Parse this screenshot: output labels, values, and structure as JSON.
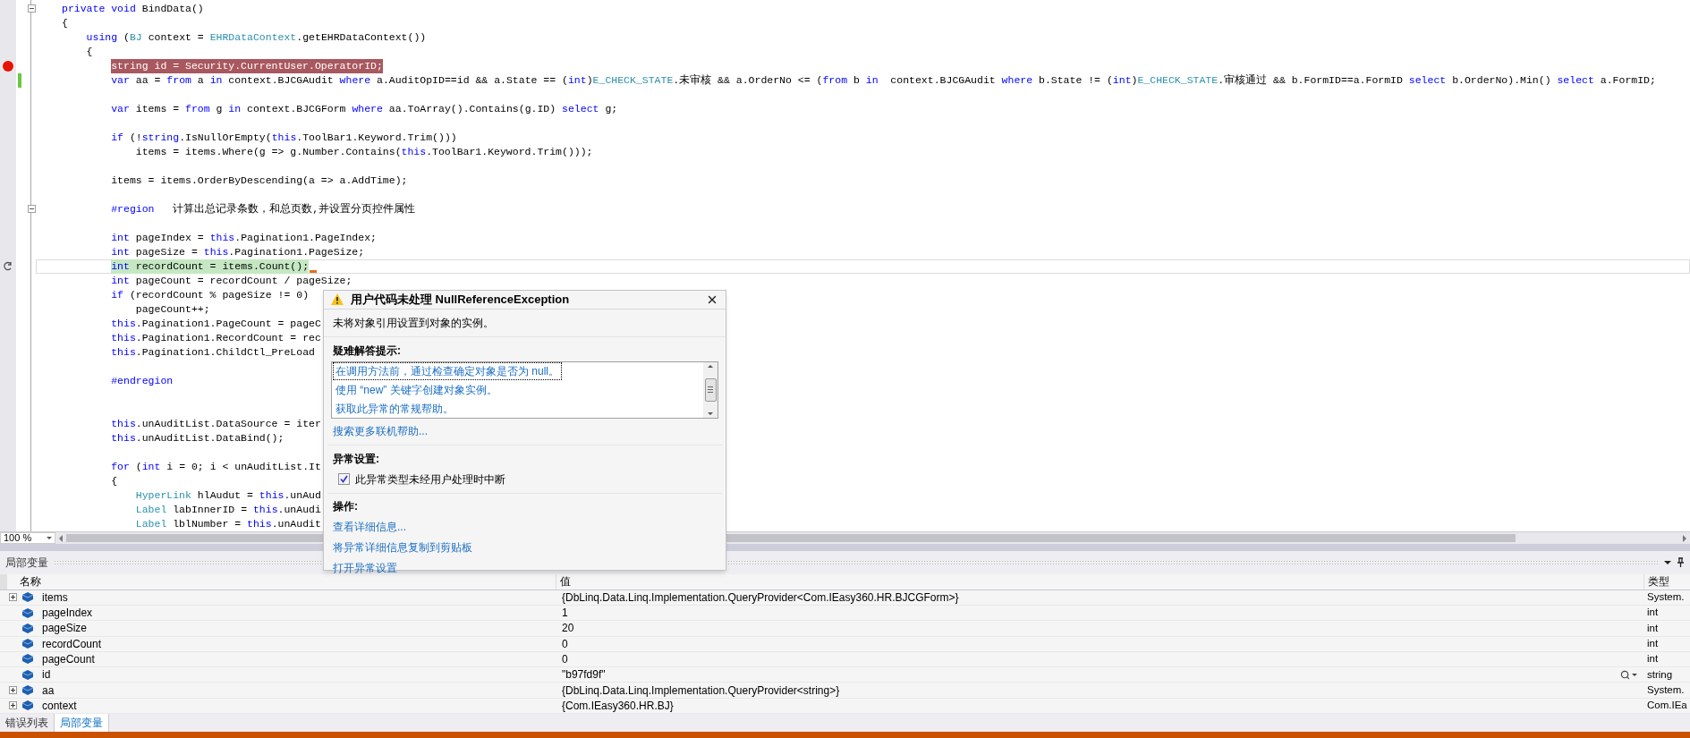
{
  "editor": {
    "lines": [
      {
        "kind": "code",
        "tokens": [
          {
            "kind": "keyword",
            "text": "private"
          },
          {
            "kind": "keyword",
            "text": " void"
          },
          {
            "kind": "plain",
            "text": " BindData()"
          }
        ],
        "foldable": true
      },
      {
        "kind": "code",
        "tokens": [
          {
            "kind": "plain",
            "text": "{"
          }
        ],
        "children": [
          {
            "kind": "code",
            "tokens": [
              {
                "kind": "keyword",
                "text": "using"
              },
              {
                "kind": "plain",
                "text": " ("
              },
              {
                "kind": "type",
                "text": "BJ"
              },
              {
                "kind": "plain",
                "text": " context = "
              },
              {
                "kind": "type",
                "text": "EHRDataContext"
              },
              {
                "kind": "plain",
                "text": ".getEHRDataContext())"
              }
            ]
          },
          {
            "kind": "code",
            "tokens": [
              {
                "kind": "plain",
                "text": "{"
              }
            ],
            "children": [
              {
                "kind": "code",
                "tokens": [
                  {
                    "kind": "plain",
                    "text": "string id = Security.CurrentUser.OperatorID;"
                  }
                ],
                "breakpoint": true
              },
              {
                "kind": "code",
                "tokens": [
                  {
                    "kind": "keyword",
                    "text": "var"
                  },
                  {
                    "kind": "plain",
                    "text": " aa = "
                  },
                  {
                    "kind": "keyword",
                    "text": "from"
                  },
                  {
                    "kind": "plain",
                    "text": " a "
                  },
                  {
                    "kind": "keyword",
                    "text": "in"
                  },
                  {
                    "kind": "plain",
                    "text": " context.BJCGAudit "
                  },
                  {
                    "kind": "keyword",
                    "text": "where"
                  },
                  {
                    "kind": "plain",
                    "text": " a.AuditOpID==id && a.State == ("
                  },
                  {
                    "kind": "keyword",
                    "text": "int"
                  },
                  {
                    "kind": "plain",
                    "text": ")"
                  },
                  {
                    "kind": "type",
                    "text": "E_CHECK_STATE"
                  },
                  {
                    "kind": "plain",
                    "text": ".未审核 && a.OrderNo <= ("
                  },
                  {
                    "kind": "keyword",
                    "text": "from"
                  },
                  {
                    "kind": "plain",
                    "text": " b "
                  },
                  {
                    "kind": "keyword",
                    "text": "in"
                  },
                  {
                    "kind": "plain",
                    "text": "  context.BJCGAudit "
                  },
                  {
                    "kind": "keyword",
                    "text": "where"
                  },
                  {
                    "kind": "plain",
                    "text": " b.State != ("
                  },
                  {
                    "kind": "keyword",
                    "text": "int"
                  },
                  {
                    "kind": "plain",
                    "text": ")"
                  },
                  {
                    "kind": "type",
                    "text": "E_CHECK_STATE"
                  },
                  {
                    "kind": "plain",
                    "text": ".审核通过 && b.FormID==a.FormID "
                  },
                  {
                    "kind": "keyword",
                    "text": "select"
                  },
                  {
                    "kind": "plain",
                    "text": " b.OrderNo).Min() "
                  },
                  {
                    "kind": "keyword",
                    "text": "select"
                  },
                  {
                    "kind": "plain",
                    "text": " a.FormID;"
                  }
                ],
                "changed": true
              },
              {
                "kind": "blank"
              },
              {
                "kind": "code",
                "tokens": [
                  {
                    "kind": "keyword",
                    "text": "var"
                  },
                  {
                    "kind": "plain",
                    "text": " items = "
                  },
                  {
                    "kind": "keyword",
                    "text": "from"
                  },
                  {
                    "kind": "plain",
                    "text": " g "
                  },
                  {
                    "kind": "keyword",
                    "text": "in"
                  },
                  {
                    "kind": "plain",
                    "text": " context.BJCGForm "
                  },
                  {
                    "kind": "keyword",
                    "text": "where"
                  },
                  {
                    "kind": "plain",
                    "text": " aa.ToArray().Contains(g.ID) "
                  },
                  {
                    "kind": "keyword",
                    "text": "select"
                  },
                  {
                    "kind": "plain",
                    "text": " g;"
                  }
                ]
              },
              {
                "kind": "blank"
              },
              {
                "kind": "code",
                "tokens": [
                  {
                    "kind": "keyword",
                    "text": "if"
                  },
                  {
                    "kind": "plain",
                    "text": " (!"
                  },
                  {
                    "kind": "keyword",
                    "text": "string"
                  },
                  {
                    "kind": "plain",
                    "text": ".IsNullOrEmpty("
                  },
                  {
                    "kind": "keyword",
                    "text": "this"
                  },
                  {
                    "kind": "plain",
                    "text": ".ToolBar1.Keyword.Trim()))"
                  }
                ],
                "children": [
                  {
                    "kind": "code",
                    "tokens": [
                      {
                        "kind": "plain",
                        "text": "items = items.Where(g => g.Number.Contains("
                      },
                      {
                        "kind": "keyword",
                        "text": "this"
                      },
                      {
                        "kind": "plain",
                        "text": ".ToolBar1.Keyword.Trim()));"
                      }
                    ]
                  }
                ]
              },
              {
                "kind": "blank"
              },
              {
                "kind": "code",
                "tokens": [
                  {
                    "kind": "plain",
                    "text": "items = items.OrderByDescending(a => a.AddTime);"
                  }
                ]
              },
              {
                "kind": "blank"
              },
              {
                "kind": "code",
                "tokens": [
                  {
                    "kind": "keyword",
                    "text": "#region"
                  },
                  {
                    "kind": "plain",
                    "text": "   计算出总记录条数，和总页数,并设置分页控件属性"
                  }
                ],
                "foldable": true
              },
              {
                "kind": "blank"
              },
              {
                "kind": "code",
                "tokens": [
                  {
                    "kind": "keyword",
                    "text": "int"
                  },
                  {
                    "kind": "plain",
                    "text": " pageIndex = "
                  },
                  {
                    "kind": "keyword",
                    "text": "this"
                  },
                  {
                    "kind": "plain",
                    "text": ".Pagination1.PageIndex;"
                  }
                ]
              },
              {
                "kind": "code",
                "tokens": [
                  {
                    "kind": "keyword",
                    "text": "int"
                  },
                  {
                    "kind": "plain",
                    "text": " pageSize = "
                  },
                  {
                    "kind": "keyword",
                    "text": "this"
                  },
                  {
                    "kind": "plain",
                    "text": ".Pagination1.PageSize;"
                  }
                ]
              },
              {
                "kind": "code",
                "tokens": [
                  {
                    "kind": "keyword",
                    "text": "int"
                  },
                  {
                    "kind": "plain",
                    "text": " recordCount = items.Count();"
                  }
                ],
                "current": true
              },
              {
                "kind": "code",
                "tokens": [
                  {
                    "kind": "keyword",
                    "text": "int"
                  },
                  {
                    "kind": "plain",
                    "text": " pageCount = recordCount / pageSize;"
                  }
                ]
              },
              {
                "kind": "code",
                "tokens": [
                  {
                    "kind": "keyword",
                    "text": "if"
                  },
                  {
                    "kind": "plain",
                    "text": " (recordCount % pageSize != 0)"
                  }
                ],
                "children": [
                  {
                    "kind": "code",
                    "tokens": [
                      {
                        "kind": "plain",
                        "text": "pageCount++;"
                      }
                    ]
                  }
                ]
              },
              {
                "kind": "code",
                "tokens": [
                  {
                    "kind": "keyword",
                    "text": "this"
                  },
                  {
                    "kind": "plain",
                    "text": ".Pagination1.PageCount = pageC"
                  }
                ]
              },
              {
                "kind": "code",
                "tokens": [
                  {
                    "kind": "keyword",
                    "text": "this"
                  },
                  {
                    "kind": "plain",
                    "text": ".Pagination1.RecordCount = rec"
                  }
                ]
              },
              {
                "kind": "code",
                "tokens": [
                  {
                    "kind": "keyword",
                    "text": "this"
                  },
                  {
                    "kind": "plain",
                    "text": ".Pagination1.ChildCtl_PreLoad"
                  }
                ]
              },
              {
                "kind": "blank"
              },
              {
                "kind": "code",
                "tokens": [
                  {
                    "kind": "keyword",
                    "text": "#endregion"
                  }
                ]
              },
              {
                "kind": "blank"
              },
              {
                "kind": "blank"
              },
              {
                "kind": "code",
                "tokens": [
                  {
                    "kind": "keyword",
                    "text": "this"
                  },
                  {
                    "kind": "plain",
                    "text": ".unAuditList.DataSource = iter"
                  }
                ]
              },
              {
                "kind": "code",
                "tokens": [
                  {
                    "kind": "keyword",
                    "text": "this"
                  },
                  {
                    "kind": "plain",
                    "text": ".unAuditList.DataBind();"
                  }
                ]
              },
              {
                "kind": "blank"
              },
              {
                "kind": "code",
                "tokens": [
                  {
                    "kind": "keyword",
                    "text": "for"
                  },
                  {
                    "kind": "plain",
                    "text": " ("
                  },
                  {
                    "kind": "keyword",
                    "text": "int"
                  },
                  {
                    "kind": "plain",
                    "text": " i = 0; i < unAuditList.It"
                  }
                ]
              },
              {
                "kind": "code",
                "tokens": [
                  {
                    "kind": "plain",
                    "text": "{"
                  }
                ],
                "children": [
                  {
                    "kind": "code",
                    "tokens": [
                      {
                        "kind": "type",
                        "text": "HyperLink"
                      },
                      {
                        "kind": "plain",
                        "text": " hlAudut = "
                      },
                      {
                        "kind": "keyword",
                        "text": "this"
                      },
                      {
                        "kind": "plain",
                        "text": ".unAud"
                      }
                    ]
                  },
                  {
                    "kind": "code",
                    "tokens": [
                      {
                        "kind": "type",
                        "text": "Label"
                      },
                      {
                        "kind": "plain",
                        "text": " labInnerID = "
                      },
                      {
                        "kind": "keyword",
                        "text": "this"
                      },
                      {
                        "kind": "plain",
                        "text": ".unAudi"
                      }
                    ]
                  },
                  {
                    "kind": "code",
                    "tokens": [
                      {
                        "kind": "type",
                        "text": "Label"
                      },
                      {
                        "kind": "plain",
                        "text": " lblNumber = "
                      },
                      {
                        "kind": "keyword",
                        "text": "this"
                      },
                      {
                        "kind": "plain",
                        "text": ".unAudit"
                      }
                    ]
                  }
                ]
              }
            ]
          }
        ]
      }
    ],
    "zoom": "100 %"
  },
  "exception_popup": {
    "title": "用户代码未处理 NullReferenceException",
    "message": "未将对象引用设置到对象的实例。",
    "troubleshooting": {
      "heading": "疑难解答提示:",
      "tips": [
        {
          "text": "在调用方法前，通过检查确定对象是否为 null。",
          "selected": true
        },
        {
          "text": "使用 “new” 关键字创建对象实例。",
          "selected": false
        },
        {
          "text": "获取此异常的常规帮助。",
          "selected": false
        }
      ],
      "more_help": "搜索更多联机帮助..."
    },
    "settings": {
      "heading": "异常设置:",
      "checkbox": {
        "label": "此异常类型未经用户处理时中断",
        "checked": true
      }
    },
    "actions": {
      "heading": "操作:",
      "links": [
        "查看详细信息...",
        "将异常详细信息复制到剪贴板",
        "打开异常设置"
      ]
    }
  },
  "locals": {
    "title": "局部变量",
    "columns": [
      "名称",
      "值",
      "类型"
    ],
    "rows": [
      {
        "name": "items",
        "value": "{DbLinq.Data.Linq.Implementation.QueryProvider<Com.IEasy360.HR.BJCGForm>}",
        "type": "System.",
        "expandable": true
      },
      {
        "name": "pageIndex",
        "value": "1",
        "type": "int",
        "expandable": false
      },
      {
        "name": "pageSize",
        "value": "20",
        "type": "int",
        "expandable": false
      },
      {
        "name": "recordCount",
        "value": "0",
        "type": "int",
        "expandable": false
      },
      {
        "name": "pageCount",
        "value": "0",
        "type": "int",
        "expandable": false
      },
      {
        "name": "id",
        "value": "\"b97fd9f\"",
        "type": "string",
        "expandable": false,
        "visualizer": true
      },
      {
        "name": "aa",
        "value": "{DbLinq.Data.Linq.Implementation.QueryProvider<string>}",
        "type": "System.",
        "expandable": true
      },
      {
        "name": "context",
        "value": "{Com.IEasy360.HR.BJ}",
        "type": "Com.IEa",
        "expandable": true
      }
    ]
  },
  "bottom_tabs": [
    {
      "label": "错误列表",
      "selected": false
    },
    {
      "label": "局部变量",
      "selected": true
    }
  ]
}
